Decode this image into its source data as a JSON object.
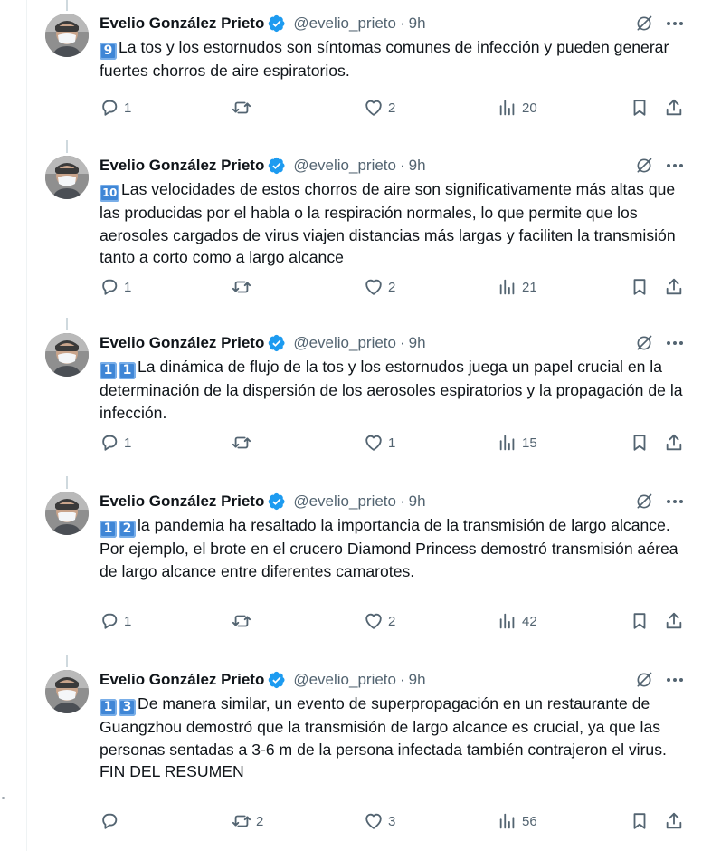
{
  "author": {
    "name": "Evelio González Prieto",
    "handle": "@evelio_prieto",
    "time_ago": "9h",
    "verified_color": "#1d9bf0"
  },
  "icons": {
    "verified": "verified-badge-icon",
    "grok": "grok-icon",
    "more": "more-options-icon",
    "reply": "reply-icon",
    "retweet": "retweet-icon",
    "like": "like-icon",
    "views": "views-icon",
    "bookmark": "bookmark-icon",
    "share": "share-icon"
  },
  "colors": {
    "text": "#0f1419",
    "muted": "#536471",
    "thread_line": "#cfd9de",
    "keycap": "#3f86d6"
  },
  "tweets": [
    {
      "badges": [
        "9"
      ],
      "text": "La tos y los estornudos son síntomas comunes de infección y pueden generar fuertes chorros de aire espiratorios.",
      "replies": "1",
      "retweets": "",
      "likes": "2",
      "views": "20"
    },
    {
      "badges": [
        "10"
      ],
      "text": "Las velocidades de estos chorros de aire son significativamente más altas que las producidas por el habla o la respiración normales, lo que permite que los aerosoles cargados de virus viajen distancias más largas y faciliten la transmisión tanto a corto como a largo alcance",
      "replies": "1",
      "retweets": "",
      "likes": "2",
      "views": "21"
    },
    {
      "badges": [
        "1",
        "1"
      ],
      "text": "La dinámica de flujo de la tos y los estornudos juega un papel crucial en la determinación de la dispersión de los aerosoles espiratorios y la propagación de la infección.",
      "replies": "1",
      "retweets": "",
      "likes": "1",
      "views": "15"
    },
    {
      "badges": [
        "1",
        "2"
      ],
      "text": "la pandemia ha resaltado la importancia de la transmisión de largo alcance.\nPor ejemplo, el brote en el crucero Diamond Princess demostró transmisión aérea de largo alcance entre diferentes camarotes.",
      "replies": "1",
      "retweets": "",
      "likes": "2",
      "views": "42"
    },
    {
      "badges": [
        "1",
        "3"
      ],
      "text": "De manera similar, un evento de superpropagación en un restaurante de Guangzhou demostró que la transmisión de largo alcance es crucial, ya que las personas sentadas a 3-6 m de la persona infectada también contrajeron el virus.\nFIN DEL RESUMEN",
      "replies": "",
      "retweets": "2",
      "likes": "3",
      "views": "56"
    }
  ]
}
